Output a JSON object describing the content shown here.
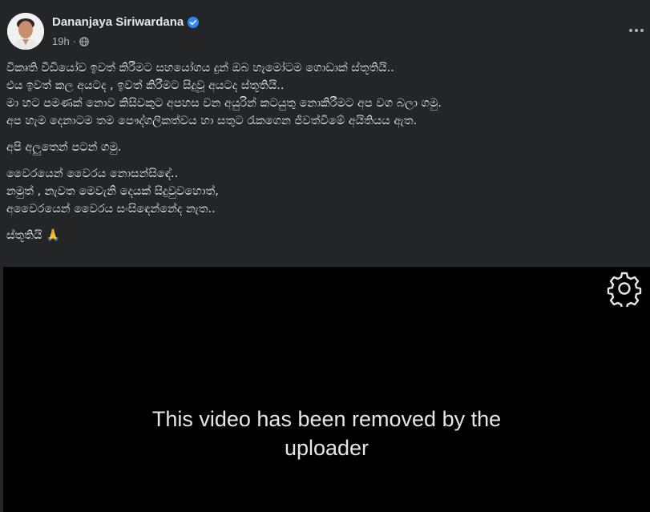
{
  "post": {
    "author": "Dananjaya Siriwardana",
    "time": "19h",
    "body": {
      "paragraphs": [
        [
          "විකෘති වීඩියෝව ඉවත් කිරීමට සහයෝගය දුන් ඔබ හැමෝටම ගොඩාක් ස්තූතියි..",
          "එය ඉවත් කල අයටද , ඉවත් කිරීමට සිදුවූ අයටද  ස්තූතියි..",
          "මා හට පමණක් නොව කිසිවකුට අපහස වන අයුරින් කටයුතු නොකිරීමට අප වග බලා ගමු.",
          "අප හැම දෙනාටම තම පෞද්ගලිකත්වය හා සතුට රැකගෙන ජීවත්වීමේ අයිතියය ඇත."
        ],
        [
          "අපි අලුතෙන් පටන් ගමු."
        ],
        [
          "වෛරයෙන් වෛරය නොසන්සිඳේ..",
          "නමුත් , නැවත මෙවැනි දෙයක් සිදුවුවහොත්,",
          "අවෛරයෙන් වෛරය සංසිඳෙන්නේද නැත.."
        ],
        [
          "ස්තූතියි 🙏"
        ]
      ]
    }
  },
  "video": {
    "message_line1": "This video has been removed by the",
    "message_line2": "uploader"
  },
  "colors": {
    "background": "#242526",
    "verified_badge": "#2d88ff",
    "text_primary": "#e4e6eb",
    "text_secondary": "#b0b3b8",
    "video_background": "#000000"
  },
  "icons": {
    "verified": "verified-badge-icon",
    "privacy": "globe-icon",
    "menu": "more-options-icon",
    "settings": "gear-icon"
  }
}
